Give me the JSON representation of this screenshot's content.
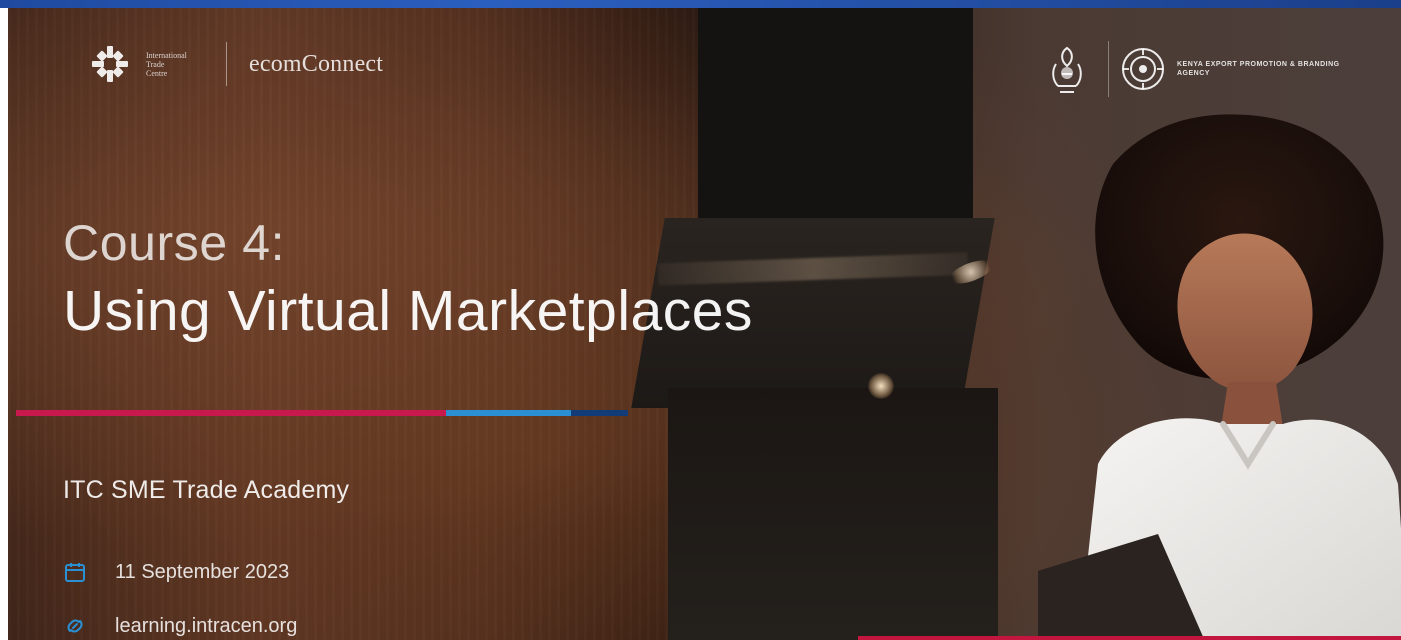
{
  "banner": {
    "brand_left": {
      "org_text_lines": [
        "International",
        "Trade",
        "Centre"
      ],
      "product_name": "ecomConnect"
    },
    "brand_right": {
      "agency_text": "KENYA EXPORT PROMOTION & BRANDING AGENCY"
    },
    "headline": {
      "course": "Course 4:",
      "title": "Using Virtual Marketplaces"
    },
    "academy": "ITC SME Trade Academy",
    "meta": {
      "date": "11 September 2023",
      "url": "learning.intracen.org",
      "date_icon": "calendar-icon",
      "url_icon": "link-icon"
    },
    "colors": {
      "underline_red": "#c8194f",
      "underline_blue": "#2b8fd3",
      "underline_navy": "#123c77",
      "accent_red_bar": "#c3163f",
      "top_stripe_blue": "#2b5fbf"
    }
  }
}
